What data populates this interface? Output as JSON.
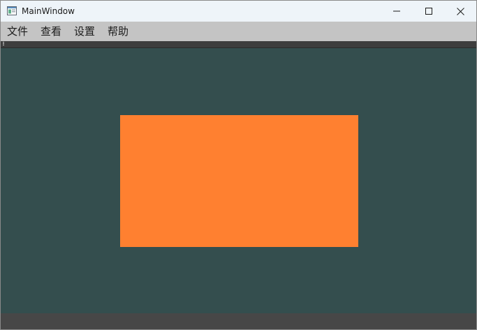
{
  "window": {
    "title": "MainWindow"
  },
  "menubar": {
    "items": [
      {
        "label": "文件"
      },
      {
        "label": "查看"
      },
      {
        "label": "设置"
      },
      {
        "label": "帮助"
      }
    ]
  },
  "canvas": {
    "background_color": "#344e4e",
    "rectangle_color": "#ff8030"
  },
  "icons": {
    "app": "app-window-icon",
    "minimize": "minimize-icon",
    "maximize": "maximize-icon",
    "close": "close-icon"
  }
}
